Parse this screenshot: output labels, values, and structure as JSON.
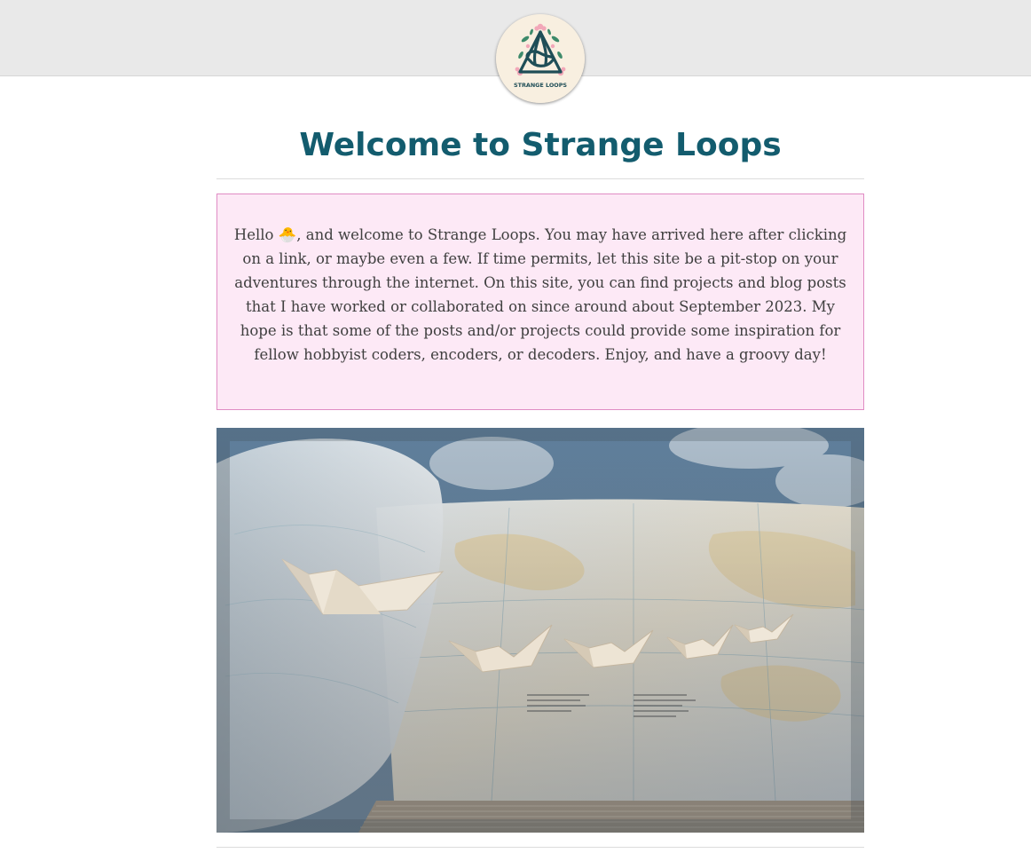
{
  "header": {
    "logo_icon": "strange-loops-logo-icon",
    "logo_text": "STRANGE LOOPS"
  },
  "main": {
    "title": "Welcome to Strange Loops",
    "welcome": {
      "greeting": "Hello",
      "emoji": "🐣",
      "text": ", and welcome to Strange Loops. You may have arrived here after clicking on a link, or maybe even a few. If time permits, let this site be a pit-stop on your adventures through the internet. On this site, you can find projects and blog posts that I have worked or collaborated on since around about September 2023. My hope is that some of the posts and/or projects could provide some inspiration for fellow hobbyist coders, encoders, or decoders. Enjoy, and have a groovy day!"
    },
    "hero_image": "paper-boats-on-atlas-image"
  },
  "colors": {
    "title": "#135c6e",
    "box_background": "#fde9f6",
    "box_border": "#e08cc4",
    "header_background": "#e9e9e9"
  }
}
